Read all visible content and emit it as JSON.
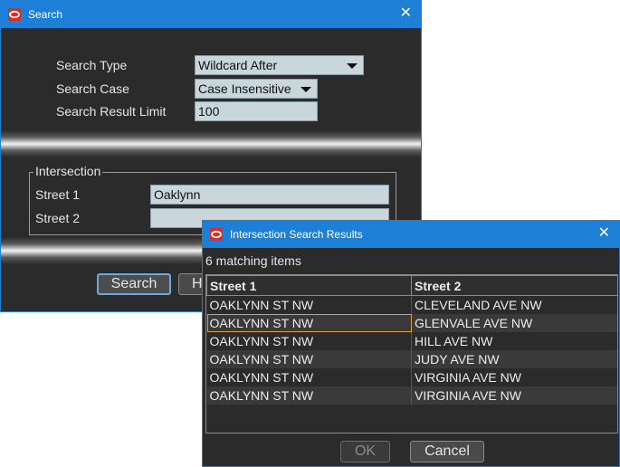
{
  "search_dialog": {
    "title": "Search",
    "search_type_label": "Search Type",
    "search_type_value": "Wildcard After",
    "search_case_label": "Search Case",
    "search_case_value": "Case Insensitive",
    "result_limit_label": "Search Result Limit",
    "result_limit_value": "100",
    "intersection_legend": "Intersection",
    "street1_label": "Street 1",
    "street1_value": "Oaklynn",
    "street2_label": "Street 2",
    "street2_value": "",
    "search_button": "Search",
    "help_button_partial": "H"
  },
  "results_dialog": {
    "title": "Intersection Search Results",
    "count_text": "6 matching items",
    "columns": [
      "Street 1",
      "Street 2"
    ],
    "rows": [
      [
        "OAKLYNN ST NW",
        "CLEVELAND AVE NW"
      ],
      [
        "OAKLYNN ST NW",
        "GLENVALE AVE NW"
      ],
      [
        "OAKLYNN ST NW",
        "HILL AVE NW"
      ],
      [
        "OAKLYNN ST NW",
        "JUDY AVE NW"
      ],
      [
        "OAKLYNN ST NW",
        "VIRGINIA AVE NW"
      ],
      [
        "OAKLYNN ST NW",
        "VIRGINIA AVE NW"
      ]
    ],
    "ok_button": "OK",
    "cancel_button": "Cancel"
  },
  "colors": {
    "titlebar": "#1e7fd6",
    "window_bg": "#2b2b2b",
    "field_bg": "#c9d7dc",
    "selection": "#e2a23a",
    "logo": "#e8251f"
  },
  "icons": {
    "app_logo": "oracle-logo-icon",
    "close": "close-icon",
    "dropdown": "chevron-down-icon"
  }
}
